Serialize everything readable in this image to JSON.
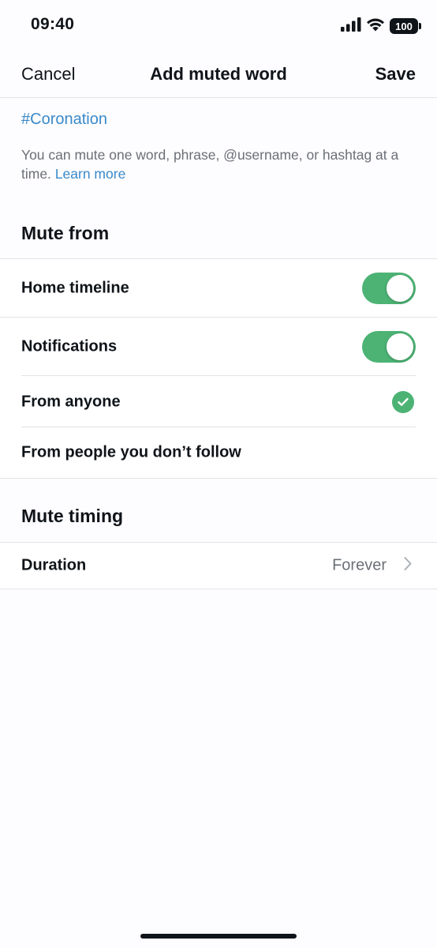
{
  "status_bar": {
    "time": "09:40",
    "battery": "100",
    "icons": [
      "cellular-signal-icon",
      "wifi-icon",
      "battery-icon"
    ]
  },
  "nav": {
    "cancel_label": "Cancel",
    "title": "Add muted word",
    "save_label": "Save"
  },
  "muted_word": {
    "value": "#Coronation",
    "hint": "You can mute one word, phrase, @username, or hashtag at a time.",
    "learn_more": "Learn more"
  },
  "mute_from": {
    "header": "Mute from",
    "home_timeline": {
      "label": "Home timeline",
      "enabled": true
    },
    "notifications": {
      "label": "Notifications",
      "enabled": true
    },
    "from_anyone": {
      "label": "From anyone",
      "selected": true
    },
    "from_not_following": {
      "label": "From people you don’t follow",
      "selected": false
    }
  },
  "mute_timing": {
    "header": "Mute timing",
    "duration_label": "Duration",
    "duration_value": "Forever"
  },
  "colors": {
    "accent_green": "#4cb374",
    "link_blue": "#3a8ac9"
  }
}
